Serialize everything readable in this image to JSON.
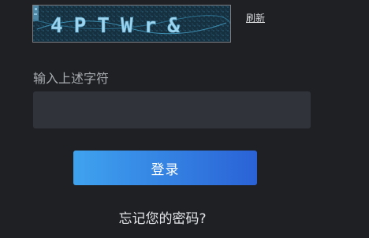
{
  "captcha": {
    "text": "4PTWr&",
    "refresh_label": "刷新"
  },
  "form": {
    "captcha_label": "输入上述字符",
    "captcha_value": "",
    "login_label": "登录",
    "forgot_label": "忘记您的密码?"
  }
}
